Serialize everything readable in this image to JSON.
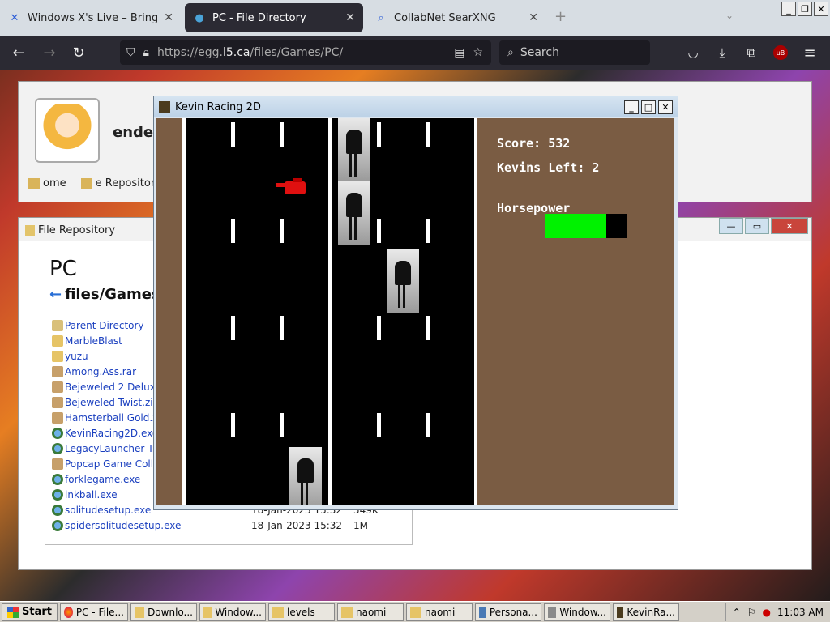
{
  "browser": {
    "tabs": [
      {
        "title": "Windows X's Live – Bringing th",
        "icon": "x-icon"
      },
      {
        "title": "PC - File Directory",
        "icon": "globe-icon"
      },
      {
        "title": "CollabNet SearXNG",
        "icon": "search-icon"
      }
    ],
    "url_host": "https://egg.",
    "url_domain": "l5.ca",
    "url_path": "/files/Games/PC/",
    "search_placeholder": "Search"
  },
  "profile": {
    "username": "ender",
    "nav": [
      "ome",
      "e Repository"
    ]
  },
  "repo": {
    "window_title": "File Repository",
    "heading": "PC",
    "path": "files/Games",
    "files": [
      {
        "name": "Parent Directory",
        "type": "up",
        "date": "",
        "size": ""
      },
      {
        "name": "MarbleBlast",
        "type": "folder",
        "date": "",
        "size": ""
      },
      {
        "name": "yuzu",
        "type": "folder",
        "date": "",
        "size": ""
      },
      {
        "name": "Among.Ass.rar",
        "type": "archive",
        "date": "",
        "size": ""
      },
      {
        "name": "Bejeweled 2 Delux",
        "type": "archive",
        "date": "",
        "size": ""
      },
      {
        "name": "Bejeweled Twist.zi",
        "type": "archive",
        "date": "",
        "size": ""
      },
      {
        "name": "Hamsterball Gold.z",
        "type": "archive",
        "date": "",
        "size": ""
      },
      {
        "name": "KevinRacing2D.exe",
        "type": "exe",
        "date": "",
        "size": ""
      },
      {
        "name": "LegacyLauncher_In",
        "type": "exe",
        "date": "",
        "size": ""
      },
      {
        "name": "Popcap Game Colle",
        "type": "archive",
        "date": "",
        "size": ""
      },
      {
        "name": "forklegame.exe",
        "type": "exe",
        "date": "",
        "size": ""
      },
      {
        "name": "inkball.exe",
        "type": "exe",
        "date": "",
        "size": ""
      },
      {
        "name": "solitudesetup.exe",
        "type": "exe",
        "date": "18-Jan-2023 15:32",
        "size": "549K"
      },
      {
        "name": "spidersolitudesetup.exe",
        "type": "exe",
        "date": "18-Jan-2023 15:32",
        "size": "1M"
      }
    ]
  },
  "game": {
    "window_title": "Kevin Racing 2D",
    "score_label": "Score: 532",
    "lives_label": "Kevins Left: 2",
    "hp_label": "Horsepower",
    "hp_fraction": 0.75,
    "hp_color": "#00f200",
    "car_color": "#e01010"
  },
  "taskbar": {
    "start": "Start",
    "tasks": [
      "PC - File...",
      "Downlo...",
      "Window...",
      "levels",
      "naomi",
      "naomi",
      "Persona...",
      "Window...",
      "KevinRa..."
    ],
    "clock": "11:03 AM"
  }
}
